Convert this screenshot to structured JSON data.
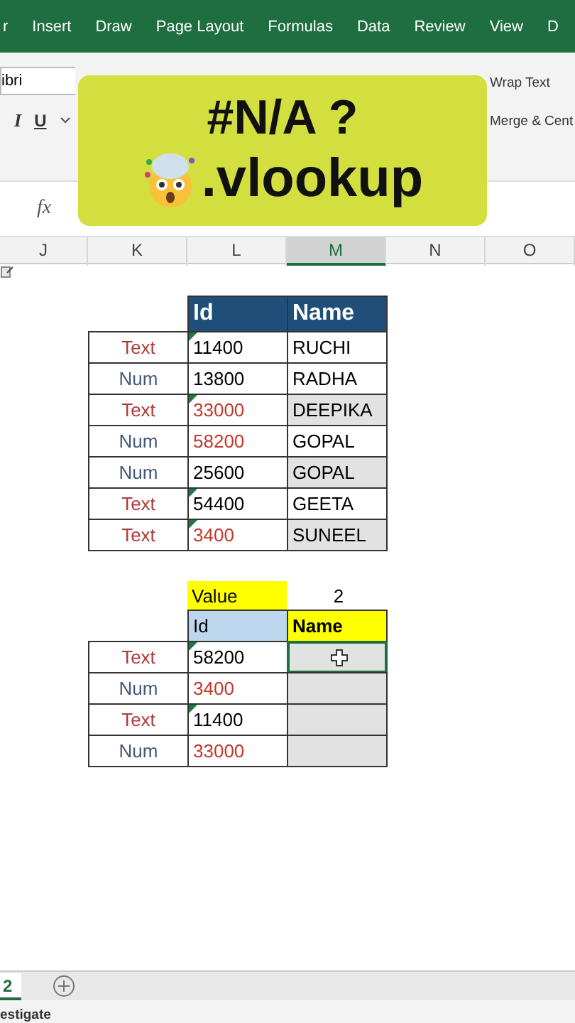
{
  "ribbon_tabs": [
    {
      "label": "r"
    },
    {
      "label": "Insert"
    },
    {
      "label": "Draw"
    },
    {
      "label": "Page Layout"
    },
    {
      "label": "Formulas"
    },
    {
      "label": "Data"
    },
    {
      "label": "Review"
    },
    {
      "label": "View"
    },
    {
      "label": "D"
    }
  ],
  "ribbon": {
    "font_name": "ibri",
    "italic": "I",
    "underline": "U",
    "wrap_text": "Wrap Text",
    "merge": "Merge & Cent"
  },
  "formula_bar": {
    "fx": "fx"
  },
  "banner": {
    "line_1": "#N/A ?",
    "line_2": ".vlookup"
  },
  "column_headers": [
    {
      "label": "J",
      "selected": false
    },
    {
      "label": "K",
      "selected": false
    },
    {
      "label": "L",
      "selected": false
    },
    {
      "label": "M",
      "selected": true
    },
    {
      "label": "N",
      "selected": false
    },
    {
      "label": "O",
      "selected": false
    }
  ],
  "table_1": {
    "headers": [
      "Id",
      "Name"
    ],
    "rows": [
      {
        "kind": "text",
        "label": "Text",
        "id": "11400",
        "flagged": false,
        "name": "RUCHI",
        "shaded": false
      },
      {
        "kind": "num",
        "label": "Num",
        "id": "13800",
        "flagged": false,
        "name": "RADHA",
        "shaded": false
      },
      {
        "kind": "text",
        "label": "Text",
        "id": "33000",
        "flagged": true,
        "name": "DEEPIKA",
        "shaded": true
      },
      {
        "kind": "num",
        "label": "Num",
        "id": "58200",
        "flagged": true,
        "name": "GOPAL",
        "shaded": false
      },
      {
        "kind": "num",
        "label": "Num",
        "id": "25600",
        "flagged": false,
        "name": "GOPAL",
        "shaded": true
      },
      {
        "kind": "text",
        "label": "Text",
        "id": "54400",
        "flagged": false,
        "name": "GEETA",
        "shaded": false
      },
      {
        "kind": "text",
        "label": "Text",
        "id": "3400",
        "flagged": true,
        "name": "SUNEEL",
        "shaded": true
      }
    ]
  },
  "table_2": {
    "value_label": "Value",
    "value": "2",
    "headers": [
      "Id",
      "Name"
    ],
    "rows": [
      {
        "kind": "text",
        "label": "Text",
        "id": "58200",
        "flagged": false,
        "selected": true
      },
      {
        "kind": "num",
        "label": "Num",
        "id": "3400",
        "flagged": true,
        "selected": false
      },
      {
        "kind": "text",
        "label": "Text",
        "id": "11400",
        "flagged": false,
        "selected": false
      },
      {
        "kind": "num",
        "label": "Num",
        "id": "33000",
        "flagged": true,
        "selected": false
      }
    ]
  },
  "sheet_tabs": [
    {
      "label": "2",
      "selected": true
    }
  ],
  "status_bar": {
    "text": "estigate"
  }
}
